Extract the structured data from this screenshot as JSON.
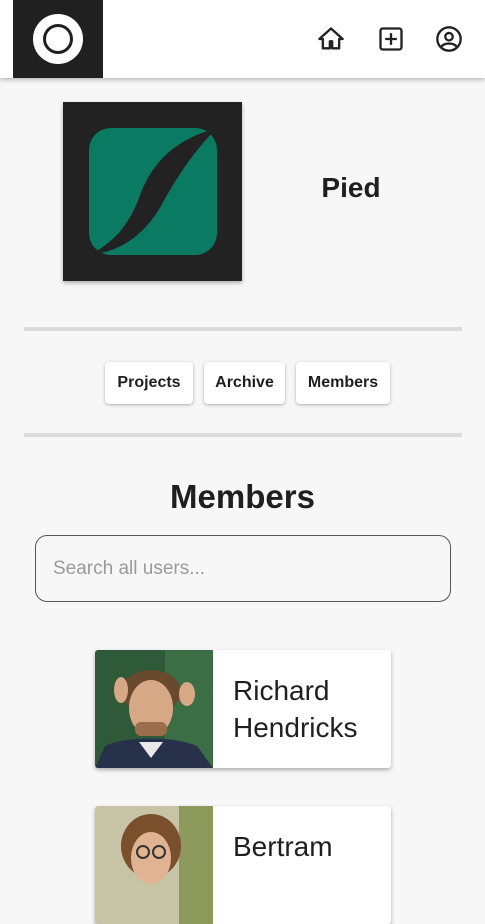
{
  "nav": {
    "logo_icon": "circle-logo-icon",
    "home_icon": "home-icon",
    "add_icon": "add-box-icon",
    "account_icon": "account-circle-icon"
  },
  "org": {
    "name": "Pied",
    "logo_icon": "pied-piper-logo",
    "logo_color": "#0a7b62"
  },
  "tabs": [
    {
      "label": "Projects"
    },
    {
      "label": "Archive"
    },
    {
      "label": "Members"
    }
  ],
  "members_section": {
    "title": "Members",
    "search_placeholder": "Search all users..."
  },
  "members": [
    {
      "name": "Richard Hendricks",
      "avatar": "richard-photo"
    },
    {
      "name": "Bertram",
      "avatar": "bertram-photo"
    }
  ]
}
